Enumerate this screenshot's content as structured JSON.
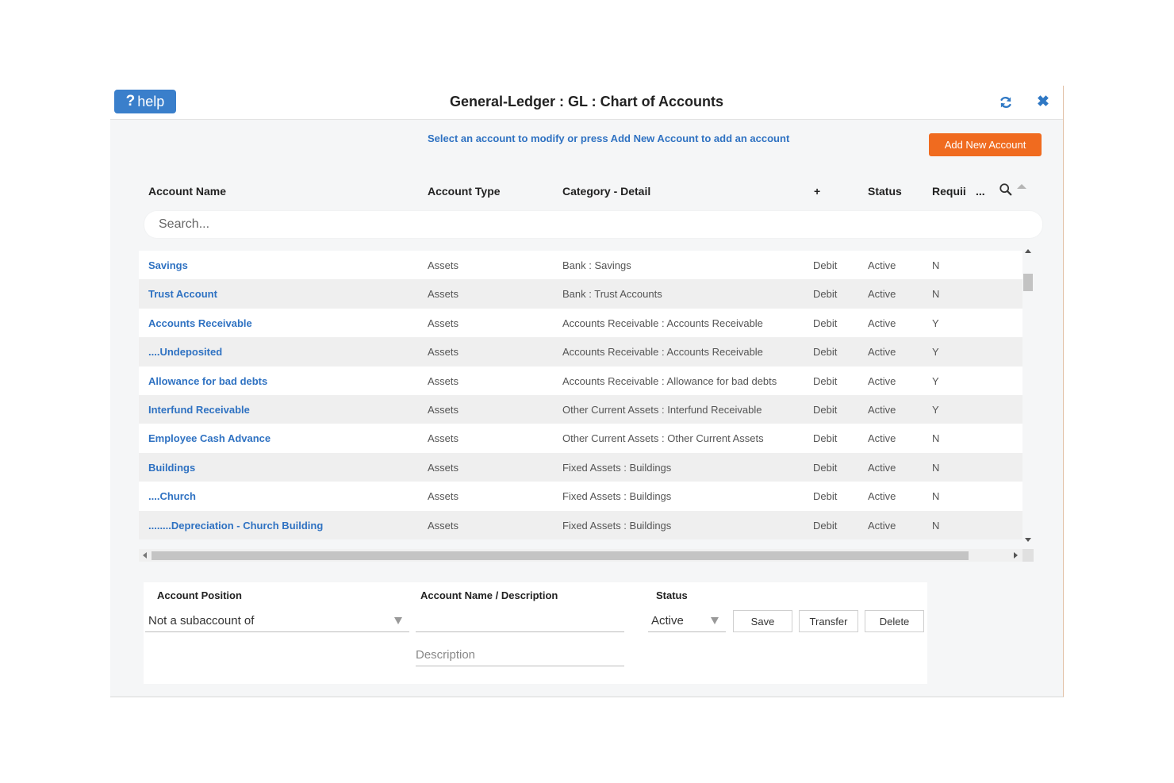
{
  "window": {
    "title": "General-Ledger : GL : Chart of Accounts",
    "help_label": "help"
  },
  "instruction": "Select an account to modify or press Add New Account to add an account",
  "add_button_label": "Add New Account",
  "columns": {
    "name": "Account Name",
    "type": "Account Type",
    "category": "Category - Detail",
    "plus": "+",
    "status": "Status",
    "required": "Requii",
    "more": "..."
  },
  "search": {
    "placeholder": "Search..."
  },
  "rows": [
    {
      "name": "Savings",
      "type": "Assets",
      "category": "Bank : Savings",
      "balance": "Debit",
      "status": "Active",
      "required": "N"
    },
    {
      "name": "Trust Account",
      "type": "Assets",
      "category": "Bank : Trust Accounts",
      "balance": "Debit",
      "status": "Active",
      "required": "N"
    },
    {
      "name": "Accounts Receivable",
      "type": "Assets",
      "category": "Accounts Receivable : Accounts Receivable",
      "balance": "Debit",
      "status": "Active",
      "required": "Y"
    },
    {
      "name": "....Undeposited",
      "type": "Assets",
      "category": "Accounts Receivable : Accounts Receivable",
      "balance": "Debit",
      "status": "Active",
      "required": "Y"
    },
    {
      "name": "Allowance for bad debts",
      "type": "Assets",
      "category": "Accounts Receivable : Allowance for bad debts",
      "balance": "Debit",
      "status": "Active",
      "required": "Y"
    },
    {
      "name": "Interfund Receivable",
      "type": "Assets",
      "category": "Other Current Assets : Interfund Receivable",
      "balance": "Debit",
      "status": "Active",
      "required": "Y"
    },
    {
      "name": "Employee Cash Advance",
      "type": "Assets",
      "category": "Other Current Assets : Other Current Assets",
      "balance": "Debit",
      "status": "Active",
      "required": "N"
    },
    {
      "name": "Buildings",
      "type": "Assets",
      "category": "Fixed Assets : Buildings",
      "balance": "Debit",
      "status": "Active",
      "required": "N"
    },
    {
      "name": "....Church",
      "type": "Assets",
      "category": "Fixed Assets : Buildings",
      "balance": "Debit",
      "status": "Active",
      "required": "N"
    },
    {
      "name": "........Depreciation - Church Building",
      "type": "Assets",
      "category": "Fixed Assets : Buildings",
      "balance": "Debit",
      "status": "Active",
      "required": "N"
    }
  ],
  "form": {
    "position_label": "Account Position",
    "position_value": "Not a subaccount of",
    "name_label": "Account Name / Description",
    "name_value": "",
    "description_placeholder": "Description",
    "status_label": "Status",
    "status_value": "Active",
    "save_label": "Save",
    "transfer_label": "Transfer",
    "delete_label": "Delete"
  },
  "colors": {
    "accent_blue": "#2f72c2",
    "help_blue": "#3a7fcb",
    "add_orange": "#f06b1f"
  }
}
